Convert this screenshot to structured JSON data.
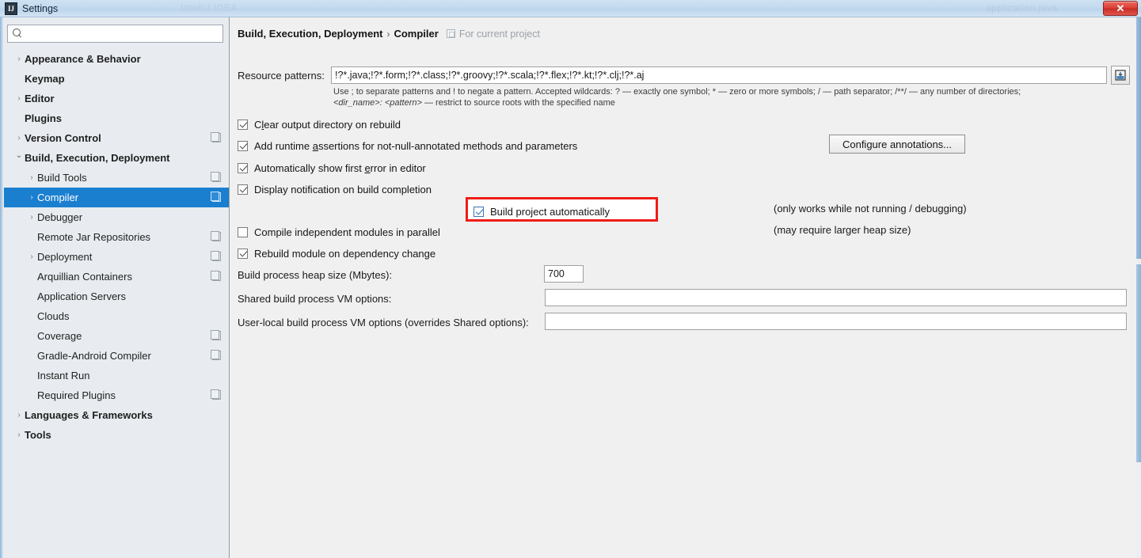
{
  "window": {
    "title": "Settings",
    "app_icon": "IJ",
    "close_label": "✕",
    "ghost_text_left": "IntelliJ IDEA",
    "ghost_text_right": "application.java"
  },
  "sidebar": {
    "search": {
      "value": "",
      "placeholder": "",
      "icon": "search-icon"
    },
    "items": [
      {
        "label": "Appearance & Behavior",
        "depth": 0,
        "bold": true,
        "arrow": "collapsed",
        "copy": false,
        "selected": false
      },
      {
        "label": "Keymap",
        "depth": 0,
        "bold": true,
        "arrow": "none",
        "copy": false,
        "selected": false
      },
      {
        "label": "Editor",
        "depth": 0,
        "bold": true,
        "arrow": "collapsed",
        "copy": false,
        "selected": false
      },
      {
        "label": "Plugins",
        "depth": 0,
        "bold": true,
        "arrow": "none",
        "copy": false,
        "selected": false
      },
      {
        "label": "Version Control",
        "depth": 0,
        "bold": true,
        "arrow": "collapsed",
        "copy": true,
        "selected": false
      },
      {
        "label": "Build, Execution, Deployment",
        "depth": 0,
        "bold": true,
        "arrow": "expanded",
        "copy": false,
        "selected": false
      },
      {
        "label": "Build Tools",
        "depth": 1,
        "bold": false,
        "arrow": "collapsed",
        "copy": true,
        "selected": false
      },
      {
        "label": "Compiler",
        "depth": 1,
        "bold": false,
        "arrow": "collapsed",
        "copy": true,
        "selected": true
      },
      {
        "label": "Debugger",
        "depth": 1,
        "bold": false,
        "arrow": "collapsed",
        "copy": false,
        "selected": false
      },
      {
        "label": "Remote Jar Repositories",
        "depth": 1,
        "bold": false,
        "arrow": "none",
        "copy": true,
        "selected": false
      },
      {
        "label": "Deployment",
        "depth": 1,
        "bold": false,
        "arrow": "collapsed",
        "copy": true,
        "selected": false
      },
      {
        "label": "Arquillian Containers",
        "depth": 1,
        "bold": false,
        "arrow": "none",
        "copy": true,
        "selected": false
      },
      {
        "label": "Application Servers",
        "depth": 1,
        "bold": false,
        "arrow": "none",
        "copy": false,
        "selected": false
      },
      {
        "label": "Clouds",
        "depth": 1,
        "bold": false,
        "arrow": "none",
        "copy": false,
        "selected": false
      },
      {
        "label": "Coverage",
        "depth": 1,
        "bold": false,
        "arrow": "none",
        "copy": true,
        "selected": false
      },
      {
        "label": "Gradle-Android Compiler",
        "depth": 1,
        "bold": false,
        "arrow": "none",
        "copy": true,
        "selected": false
      },
      {
        "label": "Instant Run",
        "depth": 1,
        "bold": false,
        "arrow": "none",
        "copy": false,
        "selected": false
      },
      {
        "label": "Required Plugins",
        "depth": 1,
        "bold": false,
        "arrow": "none",
        "copy": true,
        "selected": false
      },
      {
        "label": "Languages & Frameworks",
        "depth": 0,
        "bold": true,
        "arrow": "collapsed",
        "copy": false,
        "selected": false
      },
      {
        "label": "Tools",
        "depth": 0,
        "bold": true,
        "arrow": "collapsed",
        "copy": false,
        "selected": false
      }
    ]
  },
  "main": {
    "breadcrumb": {
      "root": "Build, Execution, Deployment",
      "separator": "›",
      "leaf": "Compiler",
      "scope_label": "For current project",
      "scope_icon": "project-scope-icon"
    },
    "resource_patterns": {
      "label": "Resource patterns:",
      "value": "!?*.java;!?*.form;!?*.class;!?*.groovy;!?*.scala;!?*.flex;!?*.kt;!?*.clj;!?*.aj",
      "placeholder": "",
      "expand_button_icon": "expand-editor-icon"
    },
    "hint_line1": "Use ; to separate patterns and ! to negate a pattern. Accepted wildcards: ? — exactly one symbol; * — zero or more symbols; / — path separator; /**/ — any number of directories;",
    "hint_line2_italic": "<dir_name>: <pattern>",
    "hint_line2_rest": " — restrict to source roots with the specified name",
    "checkboxes": [
      {
        "label_pre": "C",
        "label_underline": "l",
        "label_post": "ear output directory on rebuild",
        "checked": true,
        "highlighted": false
      },
      {
        "label_pre": "Add runtime ",
        "label_underline": "a",
        "label_post": "ssertions for not-null-annotated methods and parameters",
        "checked": true,
        "highlighted": false
      },
      {
        "label_pre": "Automatically show first ",
        "label_underline": "e",
        "label_post": "rror in editor",
        "checked": true,
        "highlighted": false
      },
      {
        "label_pre": "Display notification on build completion",
        "label_underline": "",
        "label_post": "",
        "checked": true,
        "highlighted": false
      },
      {
        "label_pre": "Build project automatically",
        "label_underline": "",
        "label_post": "",
        "checked": true,
        "highlighted": true
      },
      {
        "label_pre": "Compile independent modules in parallel",
        "label_underline": "",
        "label_post": "",
        "checked": false,
        "highlighted": false
      },
      {
        "label_pre": "Rebuild module on dependency change",
        "label_underline": "",
        "label_post": "",
        "checked": true,
        "highlighted": false
      }
    ],
    "note_build_auto": "(only works while not running / debugging)",
    "note_parallel": "(may require larger heap size)",
    "configure_annotations_button": "Configure annotations...",
    "heap_size": {
      "label": "Build process heap size (Mbytes):",
      "value": "700"
    },
    "shared_vm": {
      "label": "Shared build process VM options:",
      "value": "",
      "placeholder": ""
    },
    "user_vm": {
      "label": "User-local build process VM options (overrides Shared options):",
      "value": "",
      "placeholder": ""
    }
  },
  "colors": {
    "selection_blue": "#1b7fd0",
    "annotation_red": "#ee1c16",
    "sidebar_bg": "#e8ecf0",
    "panel_bg": "#f0f0f0",
    "titlebar_blue": "#c3d9ee"
  }
}
